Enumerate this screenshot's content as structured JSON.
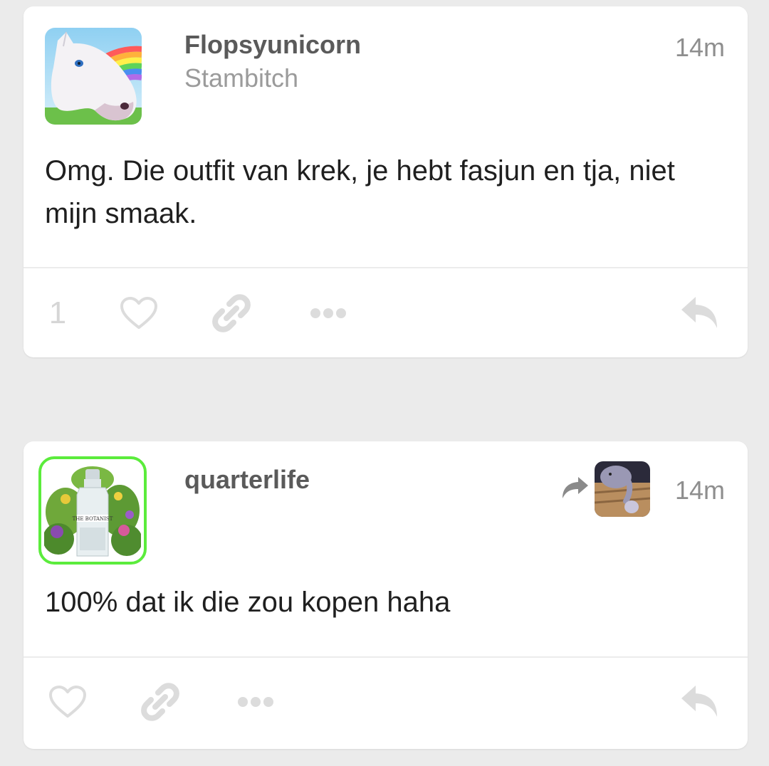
{
  "posts": [
    {
      "username": "Flopsyunicorn",
      "subtitle": "Stambitch",
      "timestamp": "14m",
      "text": "Omg. Die outfit van krek, je hebt fasjun en tja, niet mijn smaak.",
      "like_count": "1",
      "avatar_icon": "unicorn-mask-avatar"
    },
    {
      "username": "quarterlife",
      "timestamp": "14m",
      "text": "100% dat ik die zou kopen haha",
      "avatar_icon": "botanist-gin-avatar",
      "avatar_label": "THE BOTANIST",
      "reblog_avatar_icon": "cartoon-elephant-avatar"
    }
  ],
  "colors": {
    "background": "#ebebeb",
    "card": "#ffffff",
    "username": "#5a5a5a",
    "timestamp": "#8e8e8e",
    "action_icon": "#dcdcdc",
    "avatar_ring": "#5bec3c"
  }
}
